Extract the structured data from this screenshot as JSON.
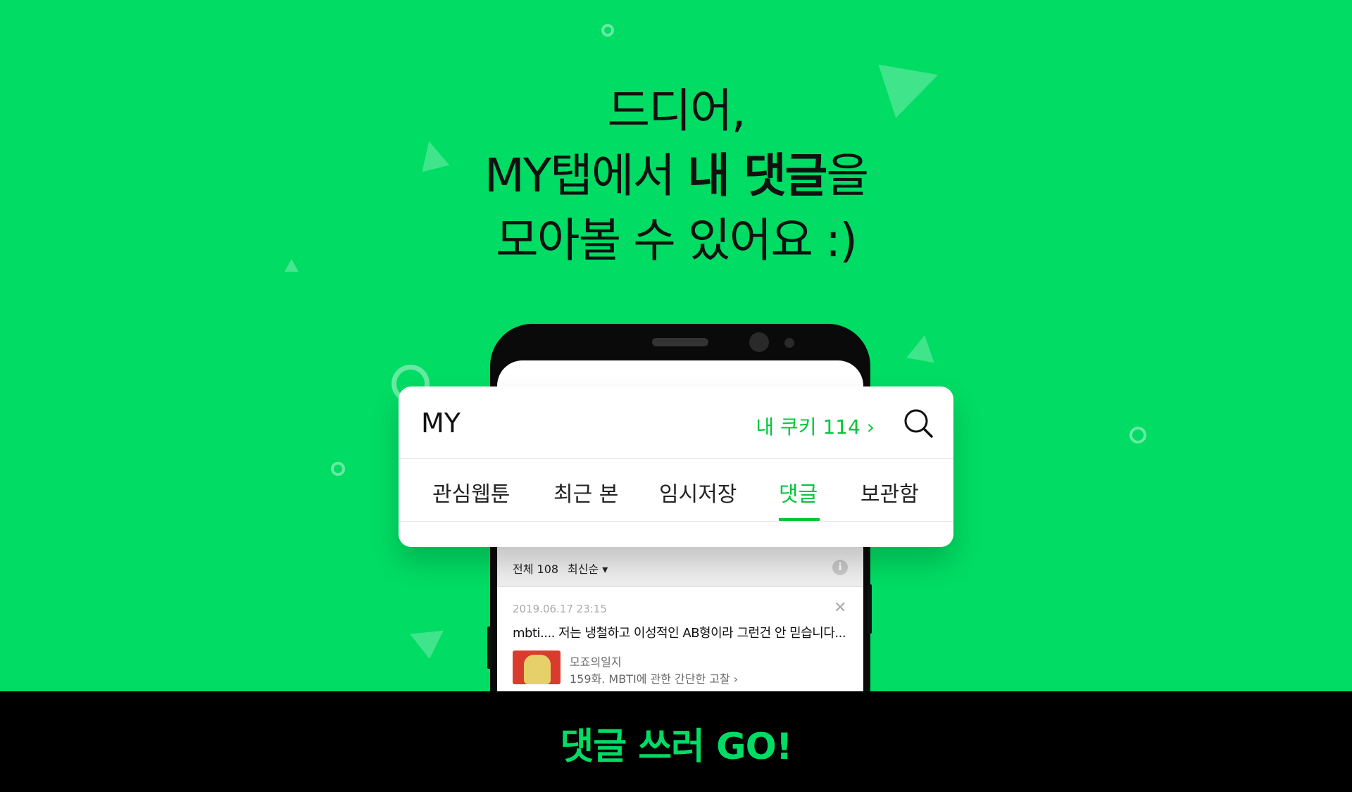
{
  "headline": {
    "line1": "드디어,",
    "line2_prefix": "MY탭에서 ",
    "line2_bold": "내 댓글",
    "line2_suffix": "을",
    "line3": "모아볼 수 있어요 :)"
  },
  "card": {
    "title": "MY",
    "cookie_label": "내 쿠키 114 ›",
    "tabs": [
      {
        "label": "관심웹툰",
        "active": false
      },
      {
        "label": "최근 본",
        "active": false
      },
      {
        "label": "임시저장",
        "active": false
      },
      {
        "label": "댓글",
        "active": true
      },
      {
        "label": "보관함",
        "active": false
      }
    ]
  },
  "list": {
    "count": "전체 108",
    "sort": "최신순 ▾",
    "info_icon": "i"
  },
  "comment": {
    "date": "2019.06.17 23:15",
    "text": "mbti.... 저는 냉철하고 이성적인 AB형이라 그런건 안 믿습니다...",
    "webtoon_title": "모죠의일지",
    "episode": "159화. MBTI에 관한 간단한 고찰 ›",
    "close_icon": "✕"
  },
  "banner": {
    "label": "댓글 쓰러 GO!"
  },
  "colors": {
    "background": "#00dc64",
    "accent": "#00c63b",
    "banner_bg": "#000000"
  }
}
